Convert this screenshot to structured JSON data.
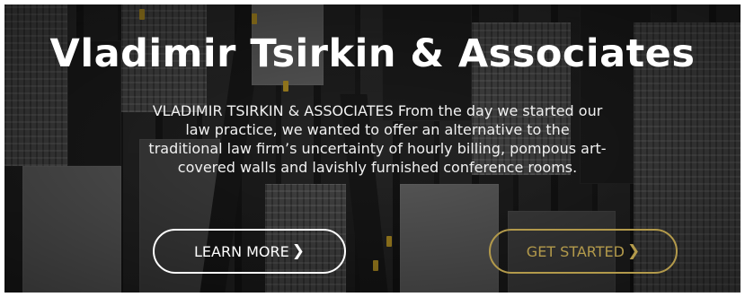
{
  "hero": {
    "title": "Vladimir Tsirkin & Associates",
    "description": "VLADIMIR TSIRKIN & ASSOCIATES From the day we started our law practice, we wanted to offer an alternative to the traditional law firm’s uncertainty of hourly billing, pompous art-covered walls and lavishly furnished conference rooms.",
    "buttons": {
      "learn_more": {
        "label": "LEARN MORE",
        "icon": "chevron-right-icon",
        "color": "#ffffff"
      },
      "get_started": {
        "label": "GET STARTED",
        "icon": "chevron-right-icon",
        "color": "#b39a4b"
      }
    }
  }
}
